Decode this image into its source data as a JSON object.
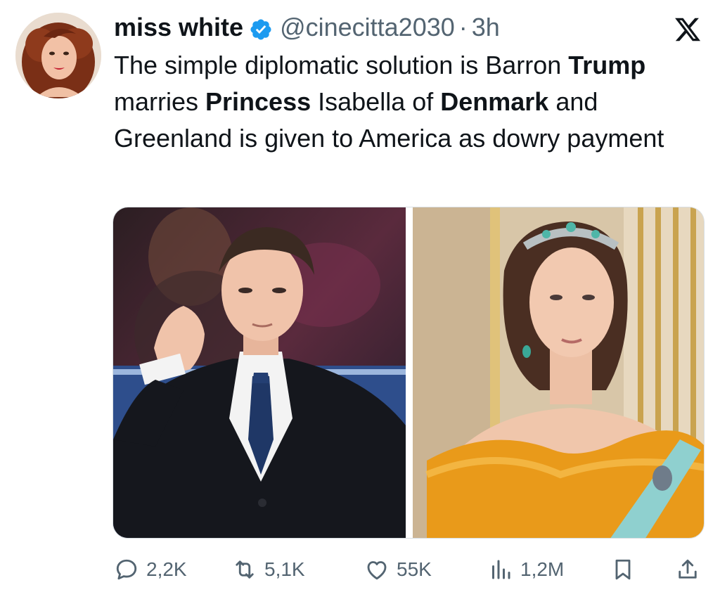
{
  "author": {
    "name": "miss white",
    "handle": "@cinecitta2030",
    "separator": "·",
    "time": "3h",
    "verified": true,
    "verified_color": "#1d9bf0"
  },
  "tweet": {
    "segments": [
      {
        "text": "The simple diplomatic solution is Barron ",
        "bold": false
      },
      {
        "text": "Trump",
        "bold": true
      },
      {
        "text": " marries ",
        "bold": false
      },
      {
        "text": "Princess",
        "bold": true
      },
      {
        "text": " Isabella of ",
        "bold": false
      },
      {
        "text": "Denmark",
        "bold": true
      },
      {
        "text": " and Greenland is given to America as dowry payment",
        "bold": false
      }
    ]
  },
  "media": {
    "count": 2
  },
  "actions": {
    "replies": "2,2K",
    "reposts": "5,1K",
    "likes": "55K",
    "views": "1,2M"
  },
  "icons": [
    "x-logo-icon",
    "verified-badge-icon",
    "reply-icon",
    "repost-icon",
    "like-icon",
    "views-icon",
    "bookmark-icon",
    "share-icon"
  ]
}
